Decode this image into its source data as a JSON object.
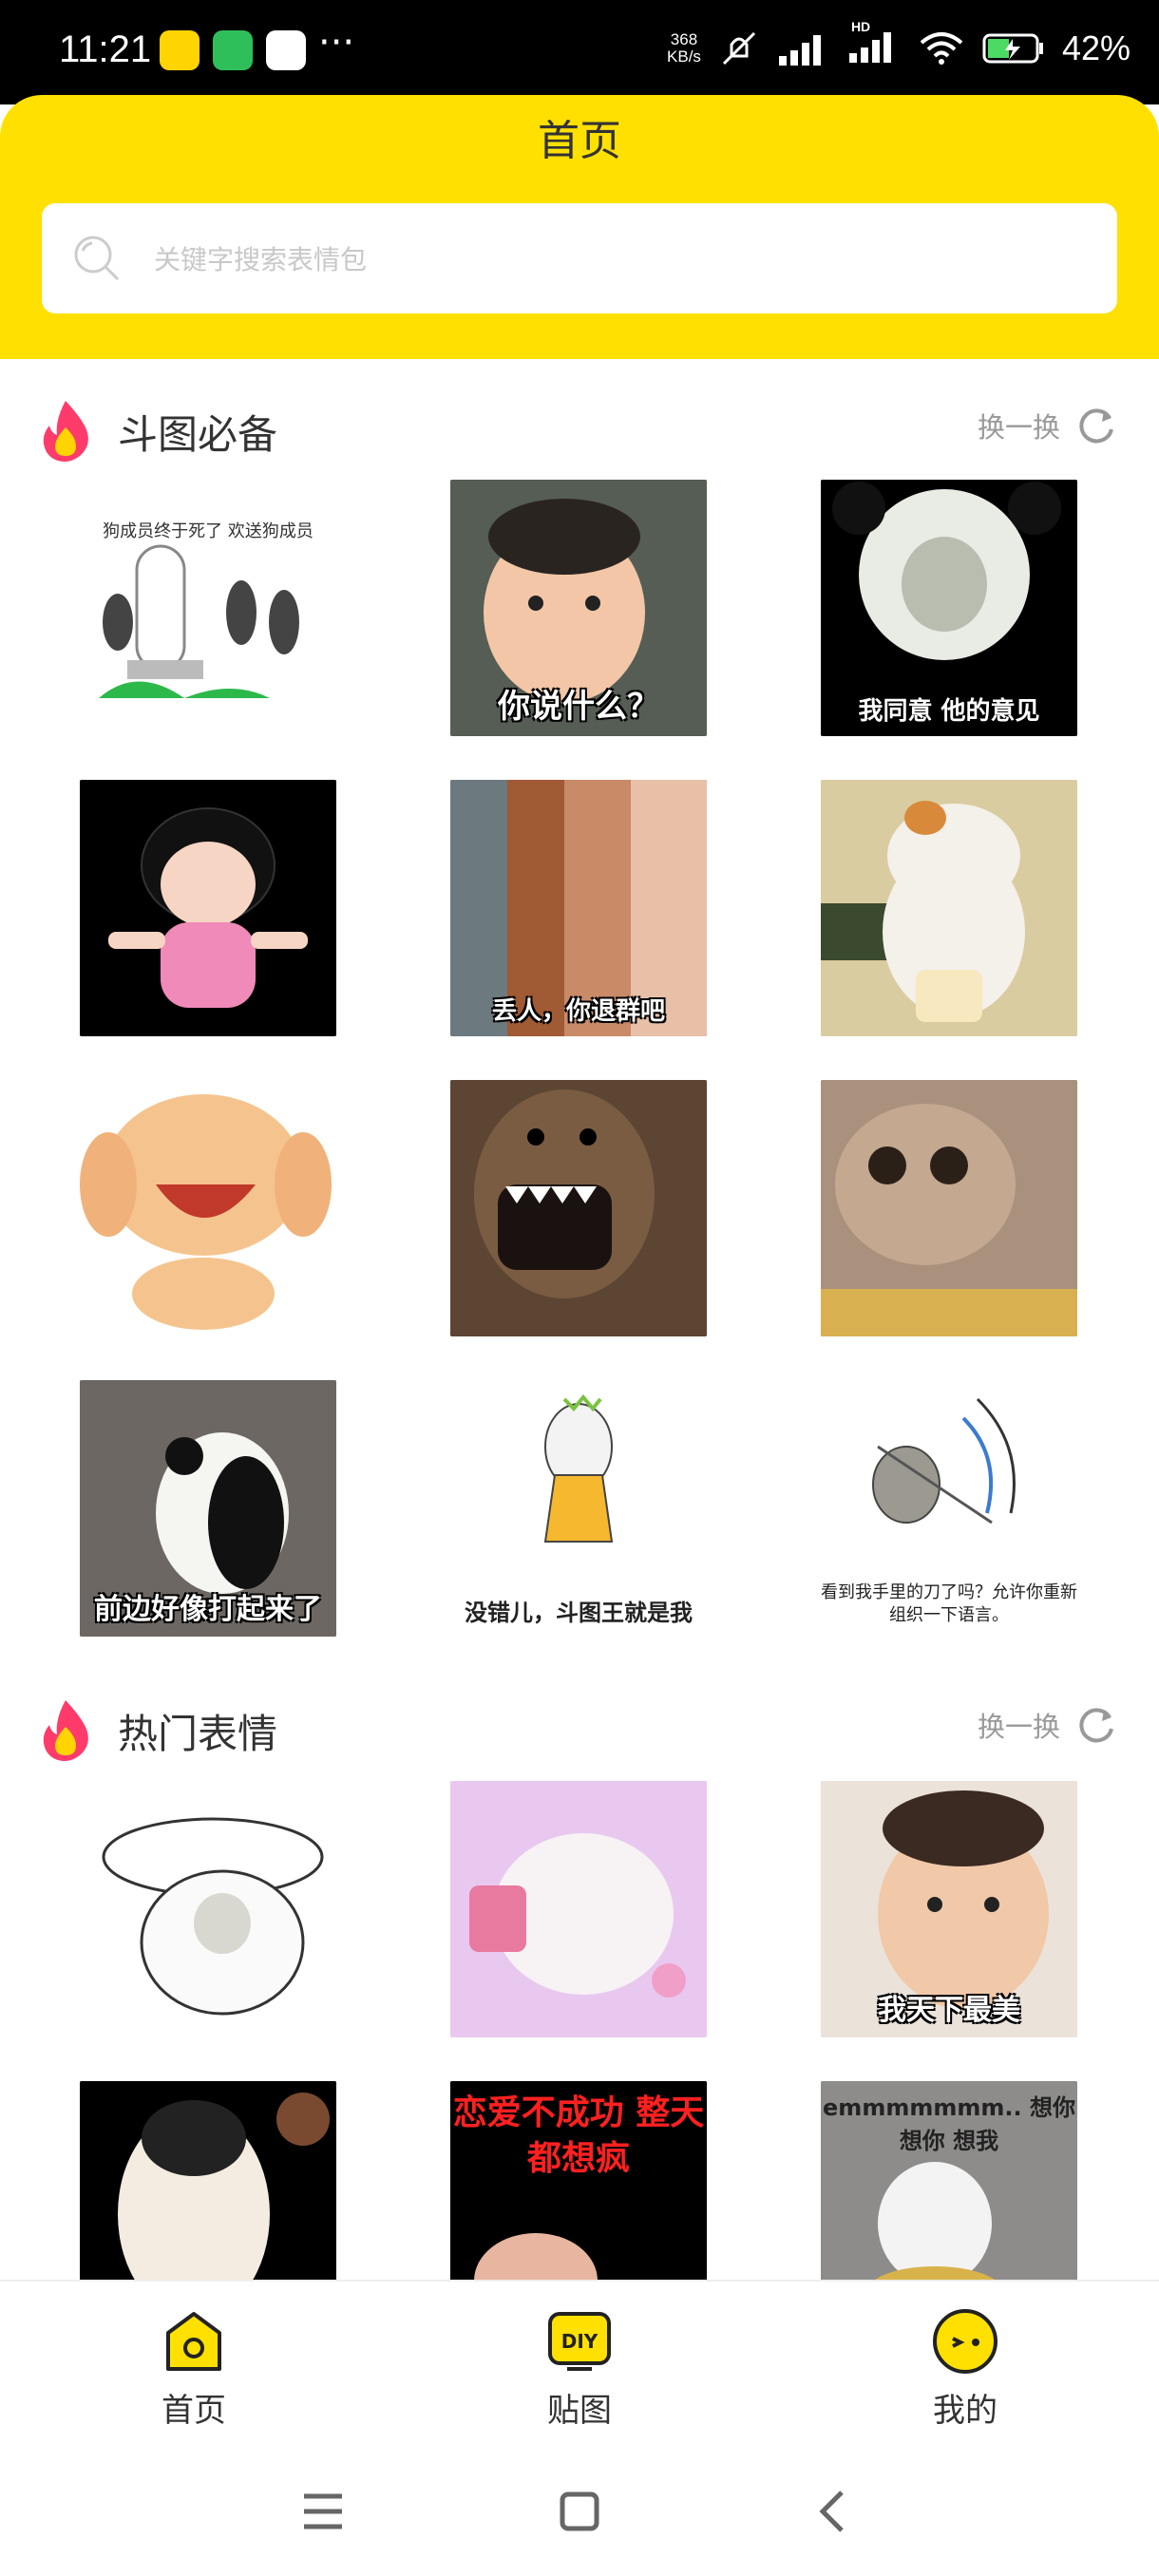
{
  "status_bar": {
    "time": "11:21",
    "more": "···",
    "net_speed_value": "368",
    "net_speed_unit": "KB/s",
    "signal_badge": "HD",
    "battery": "42%"
  },
  "header": {
    "title": "首页",
    "search_placeholder": "关键字搜索表情包",
    "background_color": "#ffe000"
  },
  "sections": [
    {
      "title": "斗图必备",
      "refresh_label": "换一换",
      "tiles": [
        {
          "caption": "",
          "top_text": "狗成员终于死了 欢送狗成员"
        },
        {
          "caption": "你说什么？"
        },
        {
          "caption": "我同意 他的意见"
        },
        {
          "caption": ""
        },
        {
          "caption": "丢人，你退群吧"
        },
        {
          "caption": ""
        },
        {
          "caption": ""
        },
        {
          "caption": ""
        },
        {
          "caption": ""
        },
        {
          "caption": "前边好像打起来了"
        },
        {
          "caption": "没错儿，斗图王就是我"
        },
        {
          "caption": "看到我手里的刀了吗？允许你重新组织一下语言。"
        }
      ]
    },
    {
      "title": "热门表情",
      "refresh_label": "换一换",
      "tiles": [
        {
          "caption": ""
        },
        {
          "caption": ""
        },
        {
          "caption": "我天下最美"
        },
        {
          "caption": ""
        },
        {
          "caption": "恋爱不成功 整天都想疯"
        },
        {
          "caption": "emmmmmmm.. 想你 想你 想我"
        }
      ]
    }
  ],
  "bottom_nav": {
    "items": [
      {
        "label": "首页",
        "icon": "home-icon"
      },
      {
        "label": "贴图",
        "icon": "diy-icon",
        "icon_text": "DIY"
      },
      {
        "label": "我的",
        "icon": "face-icon"
      }
    ],
    "accent": "#ffe000"
  },
  "system_nav": [
    "menu-icon",
    "home-square-icon",
    "back-icon"
  ]
}
